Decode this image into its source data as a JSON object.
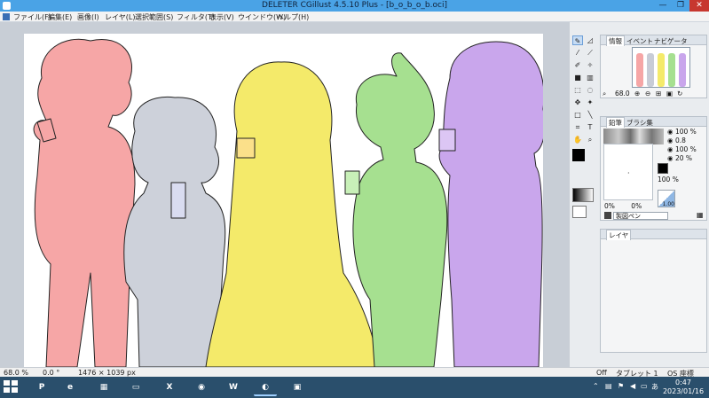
{
  "window": {
    "title": "DELETER CGillust 4.5.10 Plus - [b_o_b_o_b.oci]",
    "min_glyph": "—",
    "max_glyph": "❐",
    "close_glyph": "✕"
  },
  "menu": {
    "items": [
      "ファイル(F)",
      "編集(E)",
      "画像(I)",
      "レイヤ(L)",
      "選択範囲(S)",
      "フィルタ(T)",
      "表示(V)",
      "ウインドウ(W)",
      "ヘルプ(H)"
    ]
  },
  "navigator_panel": {
    "tabs": [
      "情報",
      "イベント",
      "ナビゲータ"
    ],
    "zoom_value": "68.0",
    "figure_colors": [
      "#f6a6a6",
      "#c8ccd6",
      "#f4ea6a",
      "#a6e090",
      "#c9a6ec"
    ]
  },
  "brush_panel": {
    "tabs": [
      "鉛筆",
      "ブラシ集"
    ],
    "brush_name": "製図ペン",
    "size_value": "100",
    "size_unit": "%",
    "opacity_value": "0.8",
    "density_value": "100",
    "density_unit": "%",
    "rotation_value": "20",
    "rotation_unit": "%",
    "preview_left": "0%",
    "preview_right": "0%",
    "preview_value": "100",
    "preview_pct": "%",
    "preview_badge": "1.00",
    "fg_color": "#000000",
    "bg_color": "#ffffff"
  },
  "layer_panel": {
    "tabs": [
      "レイヤ"
    ]
  },
  "status_bar": {
    "zoom": "68.0 %",
    "rotation": "0.0 °",
    "canvas_size": "1476 × 1039 px",
    "off_label": "Off",
    "tablet": "タブレット 1",
    "os_coords": "OS 座標"
  },
  "taskbar": {
    "apps": [
      {
        "name": "powerpoint",
        "label": "P",
        "color": "#c9442c"
      },
      {
        "name": "explorer",
        "label": "e",
        "color": "#3f7fc2"
      },
      {
        "name": "project",
        "label": "▦",
        "color": "#2f8a4a"
      },
      {
        "name": "folder",
        "label": "▭",
        "color": "#d9a93a"
      },
      {
        "name": "excel",
        "label": "X",
        "color": "#207245"
      },
      {
        "name": "chrome",
        "label": "◉",
        "color": "#d8473a"
      },
      {
        "name": "word",
        "label": "W",
        "color": "#2b5797"
      },
      {
        "name": "cgillust",
        "label": "◐",
        "color": "#5a86c4"
      },
      {
        "name": "viewer",
        "label": "▣",
        "color": "#4f8bb0"
      }
    ],
    "ime": "あ",
    "time": "0:47",
    "date": "2023/01/16"
  }
}
